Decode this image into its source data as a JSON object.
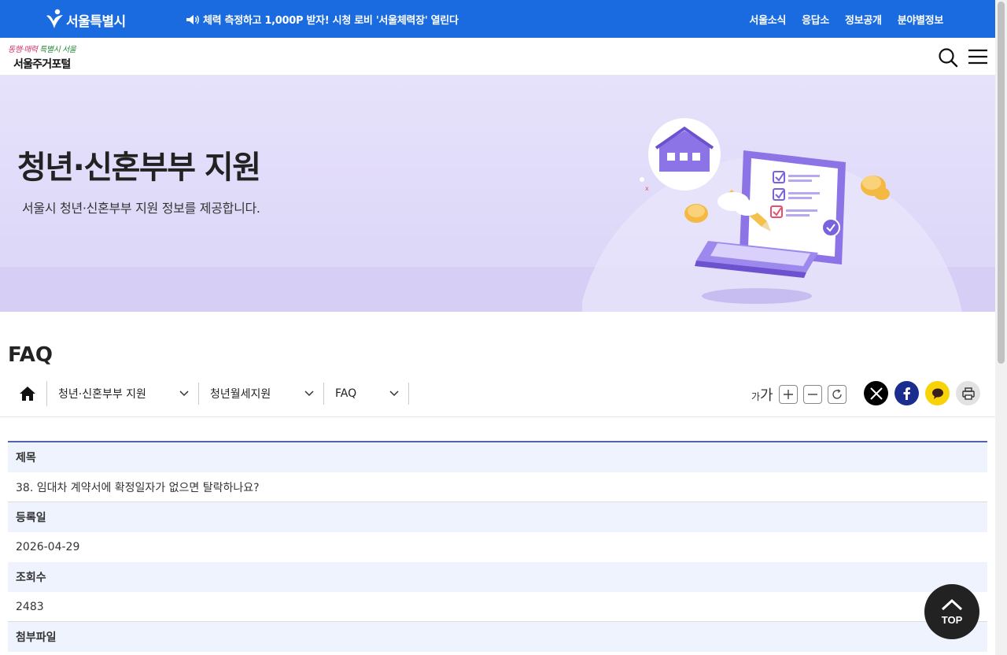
{
  "topbar": {
    "seoul_logo": "서울특별시",
    "notice": "체력 측정하고 1,000P 받자! 시청 로비 '서울체력장' 열린다",
    "nav": [
      "서울소식",
      "응답소",
      "정보공개",
      "분야별정보"
    ]
  },
  "header": {
    "slogan_a": "동행·매력",
    "slogan_b": "특별시 서울",
    "portal_name": "서울주거포털"
  },
  "banner": {
    "title": "청년·신혼부부 지원",
    "subtitle": "서울시 청년·신혼부부 지원 정보를 제공합니다."
  },
  "page": {
    "title": "FAQ"
  },
  "breadcrumb": {
    "items": [
      "청년·신혼부부 지원",
      "청년월세지원",
      "FAQ"
    ]
  },
  "font_tools": {
    "small": "가",
    "large": "가"
  },
  "detail": {
    "title_label": "제목",
    "title_value": "38. 임대차 계약서에 확정일자가 없으면 탈락하나요?",
    "date_label": "등록일",
    "date_value": "2026-04-29",
    "views_label": "조회수",
    "views_value": "2483",
    "attach_label": "첨부파일"
  },
  "top_button": {
    "label": "TOP"
  },
  "colors": {
    "topbar": "#1a6be0",
    "banner": "#e6e2fb",
    "table_header": "#eef3fd",
    "table_accent": "#5561b0"
  }
}
